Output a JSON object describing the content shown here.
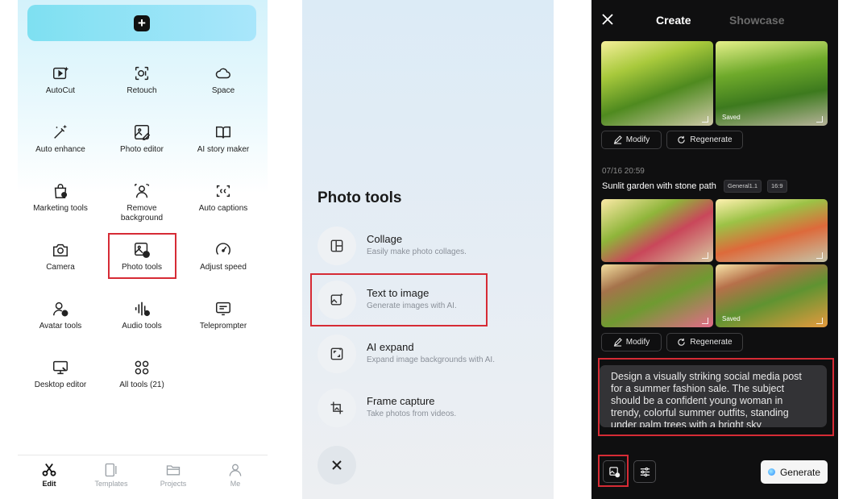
{
  "panel1": {
    "tools": [
      {
        "label": "AutoCut",
        "icon": "autocut-icon"
      },
      {
        "label": "Retouch",
        "icon": "retouch-icon"
      },
      {
        "label": "Space",
        "icon": "cloud-icon"
      },
      {
        "label": "Auto enhance",
        "icon": "magic-wand-icon"
      },
      {
        "label": "Photo editor",
        "icon": "image-edit-icon"
      },
      {
        "label": "AI story maker",
        "icon": "book-icon"
      },
      {
        "label": "Marketing tools",
        "icon": "shopping-bag-icon"
      },
      {
        "label": "Remove background",
        "label_line1": "Remove",
        "label_line2": "background",
        "icon": "remove-background-icon"
      },
      {
        "label": "Auto captions",
        "icon": "captions-icon"
      },
      {
        "label": "Camera",
        "icon": "camera-icon"
      },
      {
        "label": "Photo tools",
        "icon": "photo-tools-icon"
      },
      {
        "label": "Adjust speed",
        "icon": "speedometer-icon"
      },
      {
        "label": "Avatar tools",
        "icon": "avatar-icon"
      },
      {
        "label": "Audio tools",
        "icon": "audio-wave-icon"
      },
      {
        "label": "Teleprompter",
        "icon": "teleprompter-icon"
      },
      {
        "label": "Desktop editor",
        "icon": "desktop-icon"
      },
      {
        "label": "All tools (21)",
        "icon": "grid-icon"
      }
    ],
    "nav": [
      {
        "label": "Edit",
        "icon": "scissors-icon",
        "active": true
      },
      {
        "label": "Templates",
        "icon": "templates-icon",
        "active": false
      },
      {
        "label": "Projects",
        "icon": "folder-icon",
        "active": false
      },
      {
        "label": "Me",
        "icon": "user-icon",
        "active": false
      }
    ]
  },
  "panel2": {
    "title": "Photo tools",
    "items": [
      {
        "title": "Collage",
        "subtitle": "Easily make photo collages.",
        "icon": "collage-icon"
      },
      {
        "title": "Text to image",
        "subtitle": "Generate images with AI.",
        "icon": "text-to-image-icon"
      },
      {
        "title": "AI expand",
        "subtitle": "Expand image backgrounds with AI.",
        "icon": "expand-icon"
      },
      {
        "title": "Frame capture",
        "subtitle": "Take photos from videos.",
        "icon": "frame-capture-icon"
      }
    ]
  },
  "panel3": {
    "tabs": {
      "create": "Create",
      "showcase": "Showcase"
    },
    "saved_label": "Saved",
    "modify_label": "Modify",
    "regenerate_label": "Regenerate",
    "timestamp": "07/16 20:59",
    "prompt_title": "Sunlit garden with stone path",
    "tags": [
      "General1.1",
      "16:9"
    ],
    "prompt_text": "Design a visually striking social media post for a summer fashion sale. The subject should be a confident young woman in trendy, colorful summer outfits, standing under palm trees with a bright sky",
    "generate_label": "Generate"
  },
  "colors": {
    "highlight": "#d62b35",
    "accent": "#7ee0f1",
    "dark_bg": "#0f0f10"
  }
}
